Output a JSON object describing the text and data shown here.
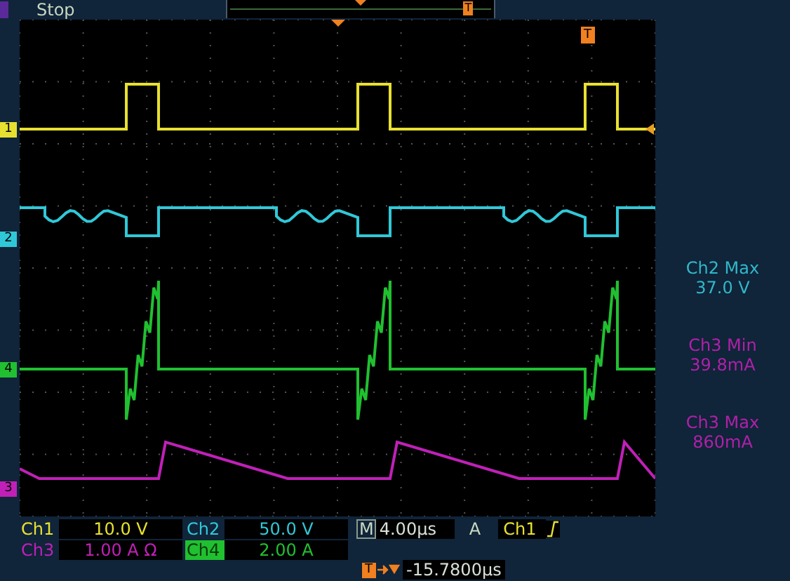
{
  "status": "Stop",
  "traces": [
    {
      "marker": "1",
      "color": "#e8e030"
    },
    {
      "marker": "2",
      "color": "#30c8d8"
    },
    {
      "marker": "4",
      "color": "#20c030"
    },
    {
      "marker": "3",
      "color": "#c020b8"
    }
  ],
  "channels": [
    {
      "label": "Ch1",
      "scale": "10.0 V",
      "color": "#e8e030",
      "label_filled": false
    },
    {
      "label": "Ch2",
      "scale": "50.0 V",
      "color": "#30c8d8",
      "label_filled": false
    },
    {
      "label": "Ch3",
      "scale": "1.00 A Ω",
      "color": "#c020b8",
      "label_filled": false
    },
    {
      "label": "Ch4",
      "scale": "2.00 A",
      "color": "#20c030",
      "label_filled": true
    }
  ],
  "measurements": [
    {
      "name": "Ch2 Max",
      "value": "37.0 V",
      "color": "#30b8c8"
    },
    {
      "name": "Ch3 Min",
      "value": "39.8mA",
      "color": "#b020a8"
    },
    {
      "name": "Ch3 Max",
      "value": "860mA",
      "color": "#b020a8"
    }
  ],
  "timebase": {
    "label": "M",
    "value": "4.00µs"
  },
  "trigger": {
    "mode": "A",
    "source": "Ch1"
  },
  "trigger_marker": "T",
  "record_marker": "T",
  "delay": {
    "marker": "T",
    "value": "-15.7800µs"
  }
}
